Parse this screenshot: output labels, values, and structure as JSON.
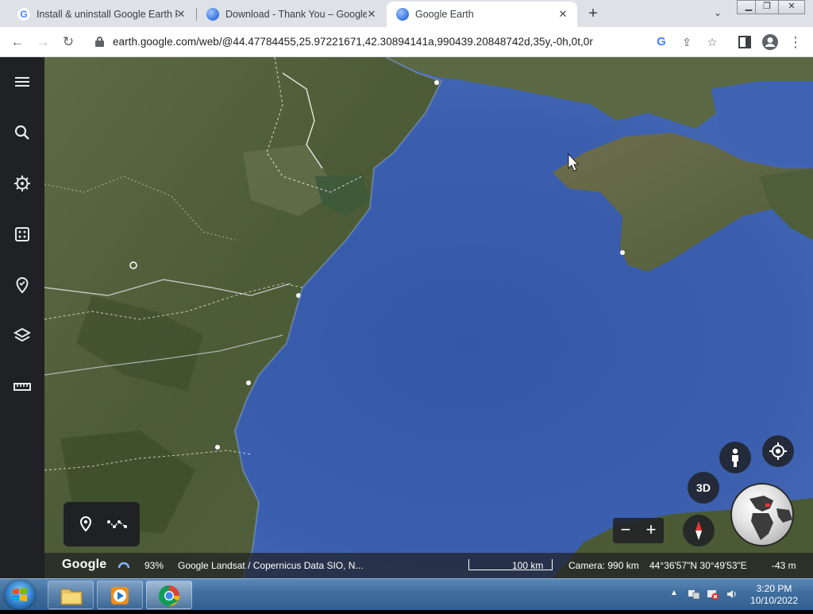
{
  "browser": {
    "tabs": [
      {
        "title": "Install & uninstall Google Earth P",
        "favicon": "google-g-icon",
        "active": false
      },
      {
        "title": "Download - Thank You – Google",
        "favicon": "earth-icon",
        "active": false
      },
      {
        "title": "Google Earth",
        "favicon": "earth-icon",
        "active": true
      }
    ],
    "new_tab_label": "+",
    "address": "earth.google.com/web/@44.47784455,25.97221671,42.30894141a,990439.20848742d,35y,-0h,0t,0r"
  },
  "earth": {
    "sidebar_icons": [
      "menu-icon",
      "search-icon",
      "voyager-icon",
      "feeling-lucky-icon",
      "projects-icon",
      "map-style-icon",
      "measure-icon"
    ],
    "controls": {
      "threed_label": "3D",
      "zoom_out": "−",
      "zoom_in": "+"
    },
    "status": {
      "logo": "Google",
      "loading_percent": "93%",
      "attribution": "Google   Landsat / Copernicus   Data SIO, N...",
      "scale": "100 km",
      "camera": "Camera: 990 km",
      "coordinates": "44°36'57\"N 30°49'53\"E",
      "elevation": "-43 m"
    }
  },
  "taskbar": {
    "apps": [
      "file-explorer-icon",
      "media-player-icon",
      "chrome-icon"
    ],
    "time": "3:20 PM",
    "date": "10/10/2022"
  },
  "colors": {
    "sea": "#3b5fae",
    "land": "#55623f",
    "sidebar": "#202124",
    "tabstrip": "#dee1e6"
  }
}
